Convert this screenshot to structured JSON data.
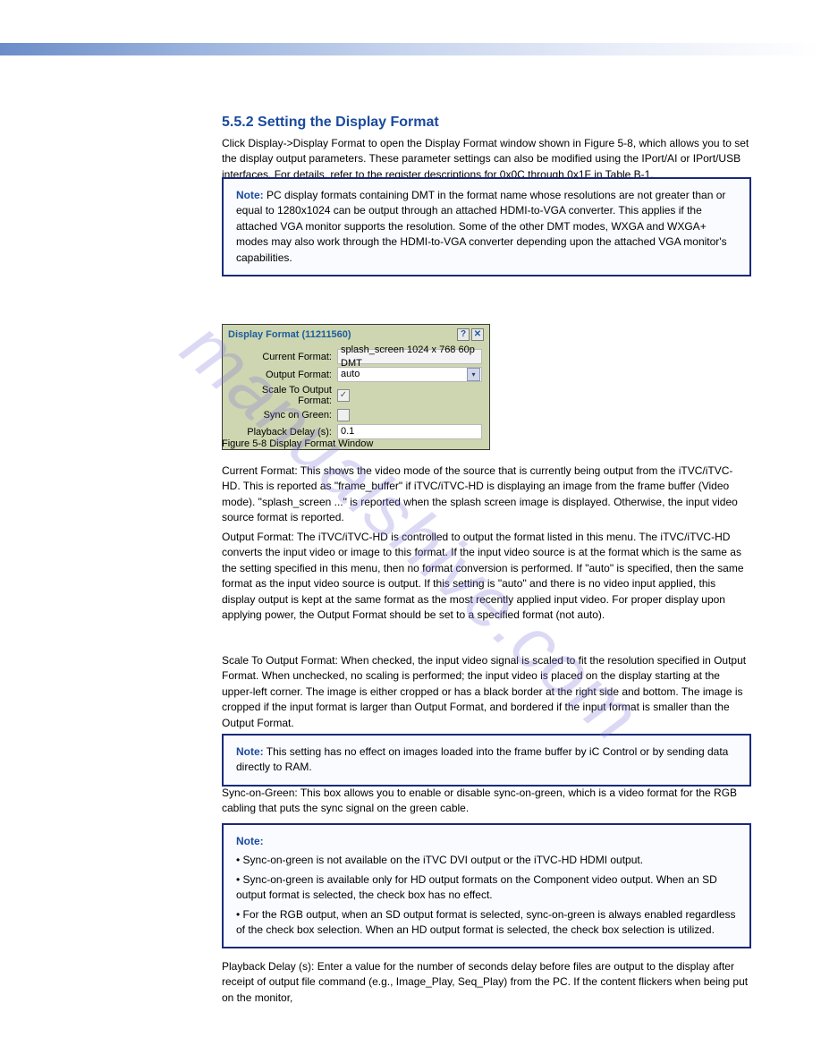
{
  "watermark": "manualshive.com",
  "sections": {
    "s1": {
      "heading": "5.5.2 Setting the Display Format",
      "p1": "Click Display->Display Format to open the Display Format window shown in Figure 5-8, which allows you to set the display output parameters. These parameter settings can also be modified using the IPort/AI or IPort/USB interfaces. For details, refer to the register descriptions for 0x0C through 0x1F in Table B-1.",
      "note1_label": "Note:",
      "note1_body": "PC display formats containing DMT in the format name whose resolutions are not greater than or equal to 1280x1024 can be output through an attached HDMI-to-VGA converter. This applies if the attached VGA monitor supports the resolution. Some of the other DMT modes, WXGA and WXGA+ modes may also work through the HDMI-to-VGA converter depending upon the attached VGA monitor's capabilities."
    },
    "dialog": {
      "title": "Display Format (11211560)",
      "rows": {
        "current_format": {
          "label": "Current Format:",
          "value": "splash_screen 1024 x 768 60p DMT"
        },
        "output_format": {
          "label": "Output Format:",
          "value": "auto"
        },
        "scale": {
          "label": "Scale To Output Format:",
          "checked": true
        },
        "sync_green": {
          "label": "Sync on Green:",
          "checked": false
        },
        "playback_delay": {
          "label": "Playback Delay (s):",
          "value": "0.1"
        }
      },
      "caption": "Figure 5-8 Display Format Window"
    },
    "s2": {
      "p1": "Current Format: This shows the video mode of the source that is currently being output from the iTVC/iTVC-HD. This is reported as \"frame_buffer\" if iTVC/iTVC-HD is displaying an image from the frame buffer (Video mode). \"splash_screen ...\" is reported when the splash screen image is displayed. Otherwise, the input video source format is reported.",
      "p2": "Output Format: The iTVC/iTVC-HD is controlled to output the format listed in this menu. The iTVC/iTVC-HD converts the input video or image to this format. If the input video source is at the format which is the same as the setting specified in this menu, then no format conversion is performed. If \"auto\" is specified, then the same format as the input video source is output. If this setting is \"auto\" and there is no video input applied, this display output is kept at the same format as the most recently applied input video. For proper display upon applying power, the Output Format should be set to a specified format (not auto).",
      "p3": "Scale To Output Format: When checked, the input video signal is scaled to fit the resolution specified in Output Format. When unchecked, no scaling is performed; the input video is placed on the display starting at the upper-left corner. The image is either cropped or has a black border at the right side and bottom. The image is cropped if the input format is larger than Output Format, and bordered if the input format is smaller than the Output Format.",
      "note2_label": "Note:",
      "note2_body": "This setting has no effect on images loaded into the frame buffer by iC Control or by sending data directly to RAM.",
      "p4": "Sync-on-Green: This box allows you to enable or disable sync-on-green, which is a video format for the RGB cabling that puts the sync signal on the green cable.",
      "note3_label": "Note:",
      "note3_list": {
        "i1": "• Sync-on-green is not available on the iTVC DVI output or the iTVC-HD HDMI output.",
        "i2": "• Sync-on-green is available only for HD output formats on the Component video output. When an SD output format is selected, the check box has no effect.",
        "i3": "• For the RGB output, when an SD output format is selected, sync-on-green is always enabled regardless of the check box selection. When an HD output format is selected, the check box selection is utilized."
      },
      "p5": "Playback Delay (s): Enter a value for the number of seconds delay before files are output to the display after receipt of output file command (e.g., Image_Play, Seq_Play) from the PC. If the content flickers when being put on the monitor,"
    }
  }
}
